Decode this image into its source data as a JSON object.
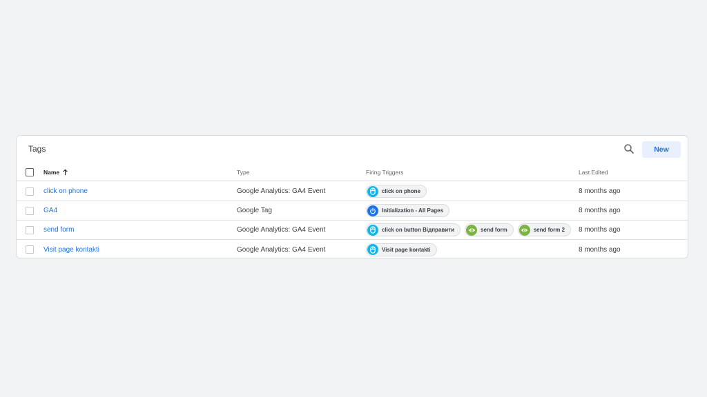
{
  "header": {
    "title": "Tags",
    "new_label": "New"
  },
  "columns": {
    "name": "Name",
    "type": "Type",
    "triggers": "Firing Triggers",
    "last_edited": "Last Edited"
  },
  "colors": {
    "link": "#1a73e8",
    "click_trigger": "#12b5ea",
    "init_trigger": "#1a73e8",
    "view_trigger": "#7cb342"
  },
  "rows": [
    {
      "name": "click on phone",
      "type": "Google Analytics: GA4 Event",
      "triggers": [
        {
          "label": "click on phone",
          "icon": "click-icon"
        }
      ],
      "last_edited": "8 months ago"
    },
    {
      "name": "GA4",
      "type": "Google Tag",
      "triggers": [
        {
          "label": "Initialization - All Pages",
          "icon": "power-icon"
        }
      ],
      "last_edited": "8 months ago"
    },
    {
      "name": "send form",
      "type": "Google Analytics: GA4 Event",
      "triggers": [
        {
          "label": "click on button Відправити",
          "icon": "click-icon"
        },
        {
          "label": "send form",
          "icon": "eye-icon"
        },
        {
          "label": "send form 2",
          "icon": "eye-icon"
        }
      ],
      "last_edited": "8 months ago"
    },
    {
      "name": "Visit page kontakti",
      "type": "Google Analytics: GA4 Event",
      "triggers": [
        {
          "label": "Visit page kontakti",
          "icon": "click-icon"
        }
      ],
      "last_edited": "8 months ago"
    }
  ]
}
